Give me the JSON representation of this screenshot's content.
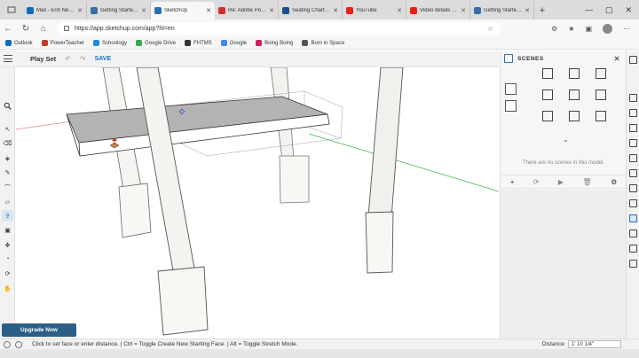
{
  "browser": {
    "tabs": [
      {
        "title": "Mail - Erin Needh",
        "color": "#0f6cbd"
      },
      {
        "title": "Getting Started w",
        "color": "#3a6ea5"
      },
      {
        "title": "SketchUp",
        "color": "#2a6fb0",
        "active": true
      },
      {
        "title": "Re: Adobe Portfol",
        "color": "#d03030"
      },
      {
        "title": "Seating Chart: Fe",
        "color": "#1c4f8a"
      },
      {
        "title": "YouTube",
        "color": "#e62117"
      },
      {
        "title": "Video details - Y",
        "color": "#e62117"
      },
      {
        "title": "Getting Started w",
        "color": "#3a6ea5"
      }
    ],
    "tab_close": "✕",
    "new_tab": "+",
    "window_controls": [
      "—",
      "▢",
      "✕"
    ],
    "url": "https://app.sketchup.com/app?hl=en",
    "bookmarks": [
      {
        "label": "Outlook",
        "color": "#0f6cbd"
      },
      {
        "label": "PowerTeacher",
        "color": "#c0392b"
      },
      {
        "label": "Schoology",
        "color": "#1e88e5"
      },
      {
        "label": "Google Drive",
        "color": "#34a853"
      },
      {
        "label": "FHTMS",
        "color": "#333333"
      },
      {
        "label": "Google",
        "color": "#4285f4"
      },
      {
        "label": "Boing Boing",
        "color": "#d81b60"
      },
      {
        "label": "Born in Space",
        "color": "#555555"
      }
    ],
    "bookmark_prefix_fhtms": "bb"
  },
  "app": {
    "project_name": "Play Set",
    "save_label": "SAVE",
    "upgrade_label": "Upgrade Now",
    "status_text": "Click to set face or enter distance. | Ctrl = Toggle Create New Starting Face. | Alt = Toggle Stretch Mode.",
    "distance_label": "Distance",
    "distance_value": "1' 10 1/4\""
  },
  "scenes_panel": {
    "title": "SCENES",
    "empty_message": "There are no scenes in this model."
  },
  "colors": {
    "accent": "#1b6fd1",
    "upgrade_bg": "#2c5f86"
  }
}
